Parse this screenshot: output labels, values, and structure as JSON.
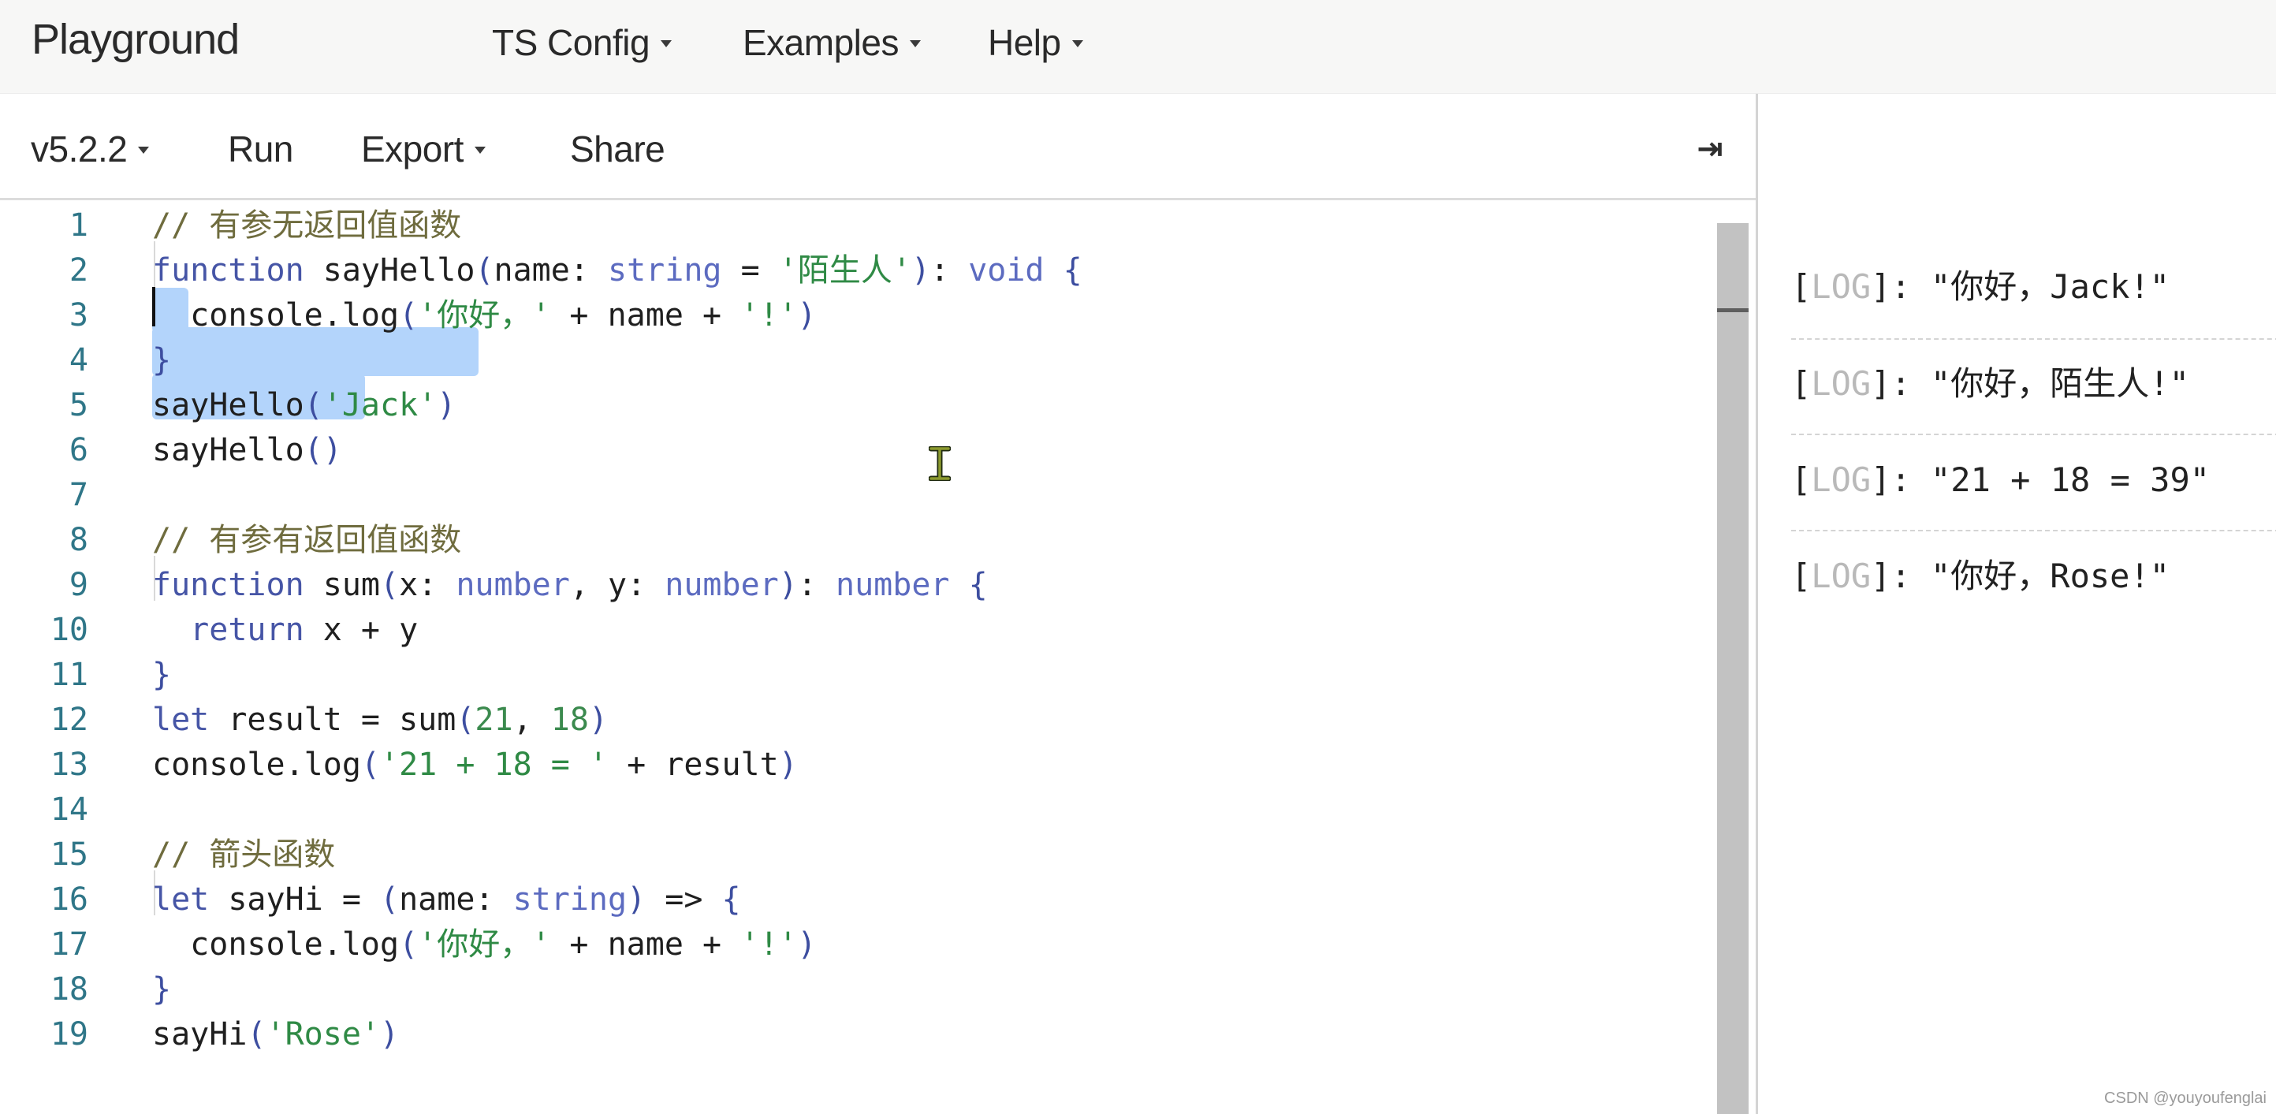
{
  "header": {
    "brand": "Playground",
    "nav": [
      {
        "label": "TS Config",
        "has_dropdown": true
      },
      {
        "label": "Examples",
        "has_dropdown": true
      },
      {
        "label": "Help",
        "has_dropdown": true
      }
    ]
  },
  "toolbar": {
    "version_label": "v5.2.2",
    "run_label": "Run",
    "export_label": "Export",
    "share_label": "Share",
    "collapse_icon": "⇥"
  },
  "editor": {
    "lines": [
      {
        "n": "1",
        "tokens": [
          {
            "t": "// 有参无返回值函数",
            "c": "com"
          }
        ]
      },
      {
        "n": "2",
        "tokens": [
          {
            "t": "function",
            "c": "kw"
          },
          {
            "t": " sayHello",
            "c": "plain"
          },
          {
            "t": "(",
            "c": "punc"
          },
          {
            "t": "name: ",
            "c": "plain"
          },
          {
            "t": "string",
            "c": "type"
          },
          {
            "t": " = ",
            "c": "plain"
          },
          {
            "t": "'陌生人'",
            "c": "str"
          },
          {
            "t": ")",
            "c": "punc"
          },
          {
            "t": ": ",
            "c": "plain"
          },
          {
            "t": "void",
            "c": "type"
          },
          {
            "t": " {",
            "c": "punc"
          }
        ]
      },
      {
        "n": "3",
        "tokens": [
          {
            "t": "  console.log",
            "c": "plain"
          },
          {
            "t": "(",
            "c": "punc"
          },
          {
            "t": "'你好，'",
            "c": "str"
          },
          {
            "t": " + name + ",
            "c": "plain"
          },
          {
            "t": "'!'",
            "c": "str"
          },
          {
            "t": ")",
            "c": "punc"
          }
        ]
      },
      {
        "n": "4",
        "tokens": [
          {
            "t": "}",
            "c": "punc"
          }
        ]
      },
      {
        "n": "5",
        "tokens": [
          {
            "t": "sayHello",
            "c": "plain"
          },
          {
            "t": "(",
            "c": "punc"
          },
          {
            "t": "'Jack'",
            "c": "str"
          },
          {
            "t": ")",
            "c": "punc"
          }
        ]
      },
      {
        "n": "6",
        "tokens": [
          {
            "t": "sayHello",
            "c": "plain"
          },
          {
            "t": "()",
            "c": "punc"
          }
        ]
      },
      {
        "n": "7",
        "tokens": []
      },
      {
        "n": "8",
        "tokens": [
          {
            "t": "// 有参有返回值函数",
            "c": "com"
          }
        ]
      },
      {
        "n": "9",
        "tokens": [
          {
            "t": "function",
            "c": "kw"
          },
          {
            "t": " sum",
            "c": "plain"
          },
          {
            "t": "(",
            "c": "punc"
          },
          {
            "t": "x: ",
            "c": "plain"
          },
          {
            "t": "number",
            "c": "type"
          },
          {
            "t": ", y: ",
            "c": "plain"
          },
          {
            "t": "number",
            "c": "type"
          },
          {
            "t": ")",
            "c": "punc"
          },
          {
            "t": ": ",
            "c": "plain"
          },
          {
            "t": "number",
            "c": "type"
          },
          {
            "t": " {",
            "c": "punc"
          }
        ]
      },
      {
        "n": "10",
        "tokens": [
          {
            "t": "  return",
            "c": "kw"
          },
          {
            "t": " x + y",
            "c": "plain"
          }
        ]
      },
      {
        "n": "11",
        "tokens": [
          {
            "t": "}",
            "c": "punc"
          }
        ]
      },
      {
        "n": "12",
        "tokens": [
          {
            "t": "let",
            "c": "kw"
          },
          {
            "t": " result = sum",
            "c": "plain"
          },
          {
            "t": "(",
            "c": "punc"
          },
          {
            "t": "21",
            "c": "num"
          },
          {
            "t": ", ",
            "c": "plain"
          },
          {
            "t": "18",
            "c": "num"
          },
          {
            "t": ")",
            "c": "punc"
          }
        ]
      },
      {
        "n": "13",
        "tokens": [
          {
            "t": "console.log",
            "c": "plain"
          },
          {
            "t": "(",
            "c": "punc"
          },
          {
            "t": "'21 + 18 = '",
            "c": "str"
          },
          {
            "t": " + result",
            "c": "plain"
          },
          {
            "t": ")",
            "c": "punc"
          }
        ]
      },
      {
        "n": "14",
        "tokens": []
      },
      {
        "n": "15",
        "tokens": [
          {
            "t": "// 箭头函数",
            "c": "com"
          }
        ]
      },
      {
        "n": "16",
        "tokens": [
          {
            "t": "let",
            "c": "kw"
          },
          {
            "t": " sayHi = ",
            "c": "plain"
          },
          {
            "t": "(",
            "c": "punc"
          },
          {
            "t": "name: ",
            "c": "plain"
          },
          {
            "t": "string",
            "c": "type"
          },
          {
            "t": ")",
            "c": "punc"
          },
          {
            "t": " => ",
            "c": "plain"
          },
          {
            "t": "{",
            "c": "punc"
          }
        ]
      },
      {
        "n": "17",
        "tokens": [
          {
            "t": "  console.log",
            "c": "plain"
          },
          {
            "t": "(",
            "c": "punc"
          },
          {
            "t": "'你好，'",
            "c": "str"
          },
          {
            "t": " + name + ",
            "c": "plain"
          },
          {
            "t": "'!'",
            "c": "str"
          },
          {
            "t": ")",
            "c": "punc"
          }
        ]
      },
      {
        "n": "18",
        "tokens": [
          {
            "t": "}",
            "c": "punc"
          }
        ]
      },
      {
        "n": "19",
        "tokens": [
          {
            "t": "sayHi",
            "c": "plain"
          },
          {
            "t": "(",
            "c": "punc"
          },
          {
            "t": "'Rose'",
            "c": "str"
          },
          {
            "t": ")",
            "c": "punc"
          }
        ]
      }
    ],
    "selected_lines": [
      "4",
      "5",
      "6"
    ]
  },
  "logs": [
    {
      "open": "[",
      "tag": "LOG",
      "close": "]: ",
      "message": "\"你好，Jack!\""
    },
    {
      "open": "[",
      "tag": "LOG",
      "close": "]: ",
      "message": "\"你好，陌生人!\""
    },
    {
      "open": "[",
      "tag": "LOG",
      "close": "]: ",
      "message": "\"21 + 18 = 39\""
    },
    {
      "open": "[",
      "tag": "LOG",
      "close": "]: ",
      "message": "\"你好，Rose!\""
    }
  ],
  "watermark": "CSDN @youyoufenglai"
}
